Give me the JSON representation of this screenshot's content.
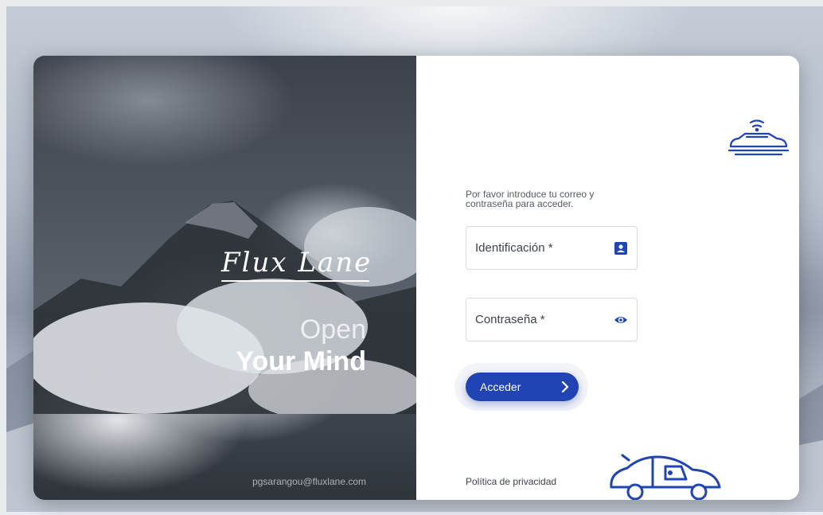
{
  "hero": {
    "logo_text": "Flux Lane",
    "tagline_line1": "Open",
    "tagline_line2": "Your Mind",
    "email": "pgsarangou@fluxlane.com"
  },
  "login": {
    "intro_line1": "Por favor introduce tu correo y",
    "intro_line2": "contraseña para acceder.",
    "id_label": "Identificación *",
    "password_label": "Contraseña *",
    "submit_label": "Acceder",
    "privacy_link": "Política de privacidad"
  },
  "colors": {
    "accent": "#2044b4",
    "panel_bg": "#ffffff"
  },
  "icons": {
    "id_field": "contact-card-icon",
    "password_field": "eye-icon",
    "submit": "chevron-right-icon",
    "brand_top": "connected-car-icon",
    "brand_bottom": "car-illustration"
  }
}
